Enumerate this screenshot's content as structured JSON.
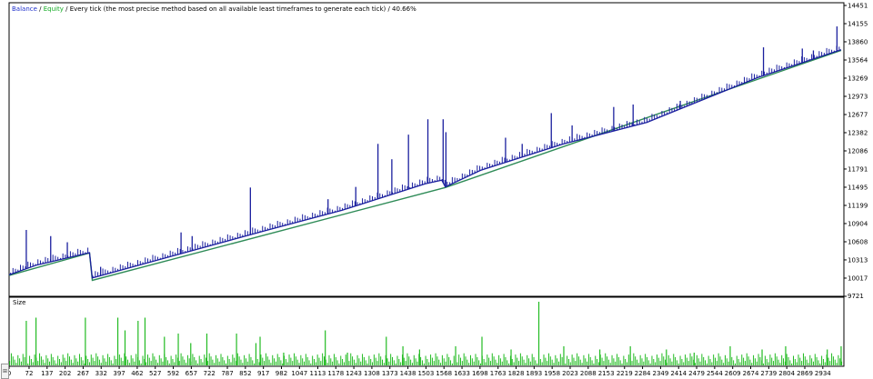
{
  "legend": {
    "balance": "Balance",
    "sep1": " / ",
    "equity": "Equity",
    "sep2": " / ",
    "model": "Every tick (the most precise method based on all available least timeframes to generate each tick)",
    "sep3": " / ",
    "quality": "40.66%"
  },
  "size_label": "Size",
  "side_handle": "⊞",
  "colors": {
    "balance": "#1a1f9e",
    "equity": "#2e8b57",
    "size": "#22bb22",
    "axis": "#000000"
  },
  "chart_data": [
    {
      "type": "line",
      "xlabel": "",
      "ylabel": "",
      "grid": false,
      "y_ticks": [
        14451,
        14155,
        13860,
        13564,
        13269,
        12973,
        12677,
        12382,
        12086,
        11791,
        11495,
        11199,
        10904,
        10608,
        10313,
        10017,
        9721
      ],
      "ylim": [
        9721,
        14451
      ],
      "x_ticks": [
        0,
        72,
        137,
        202,
        267,
        332,
        397,
        462,
        527,
        592,
        657,
        722,
        787,
        852,
        917,
        982,
        1047,
        1113,
        1178,
        1243,
        1308,
        1373,
        1438,
        1503,
        1568,
        1633,
        1698,
        1763,
        1828,
        1893,
        1958,
        2023,
        2088,
        2153,
        2219,
        2284,
        2349,
        2414,
        2479,
        2544,
        2609,
        2674,
        2739,
        2804,
        2869,
        2934
      ],
      "xlim": [
        0,
        3010
      ],
      "series": [
        {
          "name": "Balance",
          "points": [
            [
              0,
              10070
            ],
            [
              100,
              10230
            ],
            [
              290,
              10430
            ],
            [
              300,
              10020
            ],
            [
              600,
              10390
            ],
            [
              900,
              10760
            ],
            [
              1200,
              11120
            ],
            [
              1500,
              11550
            ],
            [
              1560,
              11610
            ],
            [
              1573,
              11500
            ],
            [
              1700,
              11770
            ],
            [
              2000,
              12200
            ],
            [
              2300,
              12550
            ],
            [
              2700,
              13280
            ],
            [
              3000,
              13730
            ]
          ]
        },
        {
          "name": "Equity",
          "points": [
            [
              0,
              10060
            ],
            [
              290,
              10425
            ],
            [
              300,
              9980
            ],
            [
              1573,
              11490
            ],
            [
              3000,
              13720
            ]
          ]
        }
      ],
      "spikes": [
        [
          62,
          10800
        ],
        [
          150,
          10700
        ],
        [
          210,
          10600
        ],
        [
          330,
          10200
        ],
        [
          620,
          10760
        ],
        [
          660,
          10700
        ],
        [
          870,
          11490
        ],
        [
          1150,
          11300
        ],
        [
          1250,
          11500
        ],
        [
          1330,
          12200
        ],
        [
          1380,
          11950
        ],
        [
          1440,
          12350
        ],
        [
          1510,
          12600
        ],
        [
          1565,
          12600
        ],
        [
          1575,
          12390
        ],
        [
          1790,
          12300
        ],
        [
          1850,
          12200
        ],
        [
          1955,
          12700
        ],
        [
          2030,
          12500
        ],
        [
          2180,
          12800
        ],
        [
          2250,
          12840
        ],
        [
          2420,
          12900
        ],
        [
          2550,
          13000
        ],
        [
          2720,
          13770
        ],
        [
          2860,
          13750
        ],
        [
          2900,
          13720
        ],
        [
          2985,
          14110
        ]
      ]
    },
    {
      "type": "bar",
      "title": "Size",
      "grid": false,
      "note": "trade volume histogram, relative heights (0-1)",
      "bars": [
        [
          62,
          0.7
        ],
        [
          97,
          0.75
        ],
        [
          275,
          0.75
        ],
        [
          392,
          0.75
        ],
        [
          418,
          0.55
        ],
        [
          465,
          0.7
        ],
        [
          490,
          0.75
        ],
        [
          560,
          0.45
        ],
        [
          610,
          0.5
        ],
        [
          655,
          0.35
        ],
        [
          713,
          0.5
        ],
        [
          820,
          0.5
        ],
        [
          890,
          0.35
        ],
        [
          905,
          0.45
        ],
        [
          990,
          0.2
        ],
        [
          1140,
          0.55
        ],
        [
          1220,
          0.2
        ],
        [
          1360,
          0.45
        ],
        [
          1420,
          0.3
        ],
        [
          1480,
          0.25
        ],
        [
          1610,
          0.3
        ],
        [
          1705,
          0.45
        ],
        [
          1810,
          0.25
        ],
        [
          1910,
          1.0
        ],
        [
          2000,
          0.3
        ],
        [
          2130,
          0.25
        ],
        [
          2240,
          0.3
        ],
        [
          2370,
          0.25
        ],
        [
          2470,
          0.2
        ],
        [
          2600,
          0.3
        ],
        [
          2715,
          0.25
        ],
        [
          2800,
          0.3
        ],
        [
          2950,
          0.25
        ],
        [
          3000,
          0.3
        ]
      ]
    }
  ]
}
